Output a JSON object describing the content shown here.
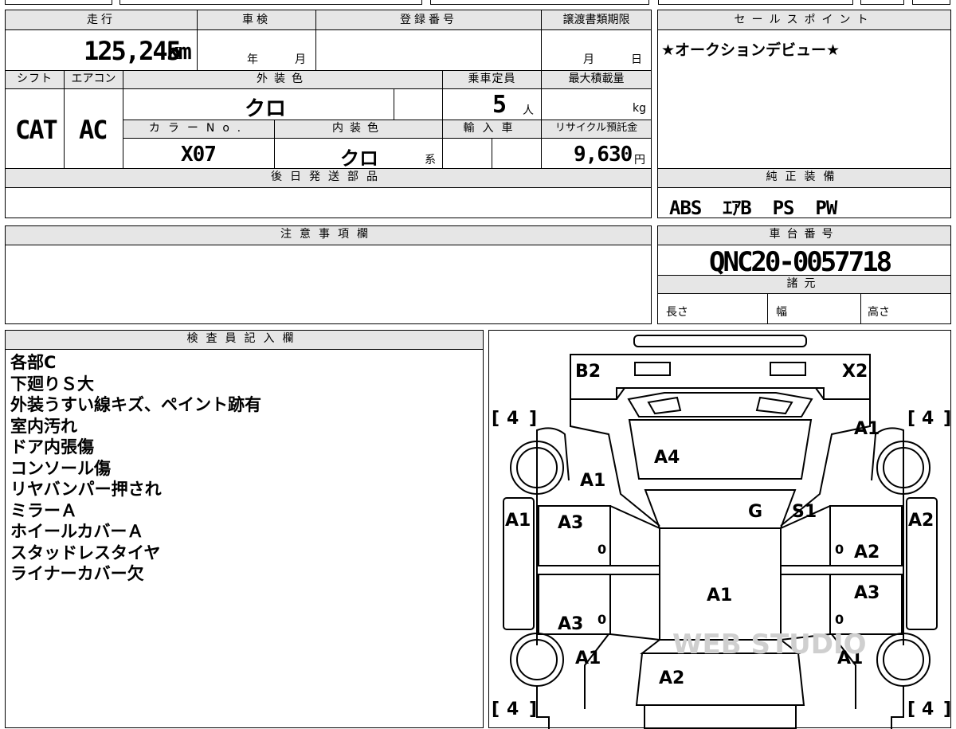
{
  "top": {
    "mileage_label": "走行",
    "mileage_value": "125,245",
    "mileage_unit": "km",
    "shaken_label": "車検",
    "shaken_year_unit": "年",
    "shaken_month_unit": "月",
    "reg_label": "登録番号",
    "transfer_label": "譲渡書類期限",
    "transfer_month_unit": "月",
    "transfer_day_unit": "日"
  },
  "row2": {
    "shift_label": "シフト",
    "shift_value": "CAT",
    "ac_label": "エアコン",
    "ac_value": "AC",
    "ext_color_label": "外装色",
    "ext_color_value": "クロ",
    "capacity_label": "乗車定員",
    "capacity_value": "5",
    "capacity_unit": "人",
    "max_load_label": "最大積載量",
    "max_load_unit": "kg",
    "color_no_label": "カラーNo.",
    "color_no_value": "X07",
    "int_color_label": "内装色",
    "int_color_value": "クロ",
    "int_color_suffix": "系",
    "import_label": "輸入車",
    "recycle_label": "リサイクル預託金",
    "recycle_value": "9,630",
    "recycle_unit": "円"
  },
  "later_parts_label": "後日発送部品",
  "sales_point": {
    "label": "セールスポイント",
    "text": "★オークションデビュー★"
  },
  "equipment": {
    "label": "純正装備",
    "text": "ABS  ｴｱB  PS  PW"
  },
  "caution_label": "注意事項欄",
  "chassis": {
    "label": "車台番号",
    "value": "QNC20-0057718",
    "specs_label": "諸元",
    "length_label": "長さ",
    "width_label": "幅",
    "height_label": "高さ"
  },
  "inspector": {
    "label": "検査員記入欄",
    "notes": [
      "各部C",
      "下廻りＳ大",
      "外装うすい線キズ、ペイント跡有",
      "室内汚れ",
      "ドア内張傷",
      "コンソール傷",
      "リヤバンパー押され",
      "ミラーＡ",
      "ホイールカバーＡ",
      "スタッドレスタイヤ",
      "ライナーカバー欠"
    ]
  },
  "diagram": {
    "tire_depth": "4",
    "rear_left": "B2",
    "rear_right": "X2",
    "marks": {
      "rear_glass": "A4",
      "left_rear_fender": "A1",
      "right_rear_fender": "A1",
      "left_rear_quarter_side": "A1",
      "right_rear_quarter_side": "A2",
      "left_rear_door": "A3",
      "right_rear_door": "A2",
      "left_front_door": "A3",
      "right_front_door": "A3",
      "roof": "A1",
      "left_front_fender": "A1",
      "right_front_fender": "A1",
      "hood": "A2",
      "glass": "G",
      "s1": "S1",
      "zero": "0"
    },
    "watermark": "WEB STUDIO"
  }
}
